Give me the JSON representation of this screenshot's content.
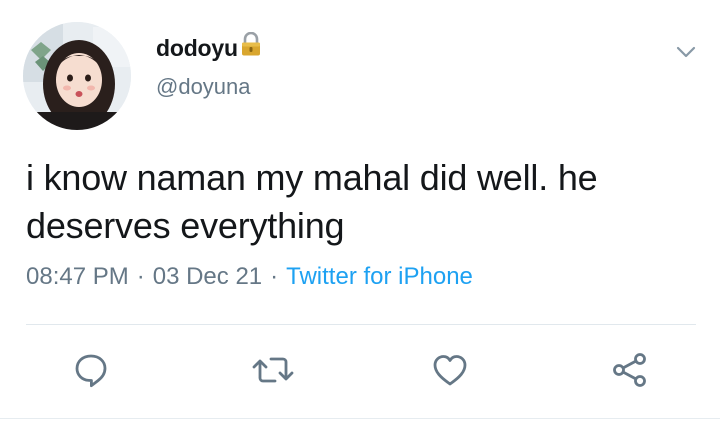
{
  "tweet": {
    "display_name": "dodoyu",
    "handle": "@doyuna",
    "text": "i know naman my mahal did well. he deserves everything",
    "time": "08:47 PM",
    "date": "03 Dec 21",
    "separator": "·",
    "source": "Twitter for iPhone"
  },
  "icons": {
    "lock": "lock-icon",
    "caret": "chevron-down-icon",
    "reply": "reply-icon",
    "retweet": "retweet-icon",
    "like": "heart-icon",
    "share": "share-icon"
  },
  "colors": {
    "text": "#14171a",
    "secondary": "#657786",
    "link": "#1da1f2",
    "icon": "#657786",
    "divider": "#e1e8ed"
  }
}
